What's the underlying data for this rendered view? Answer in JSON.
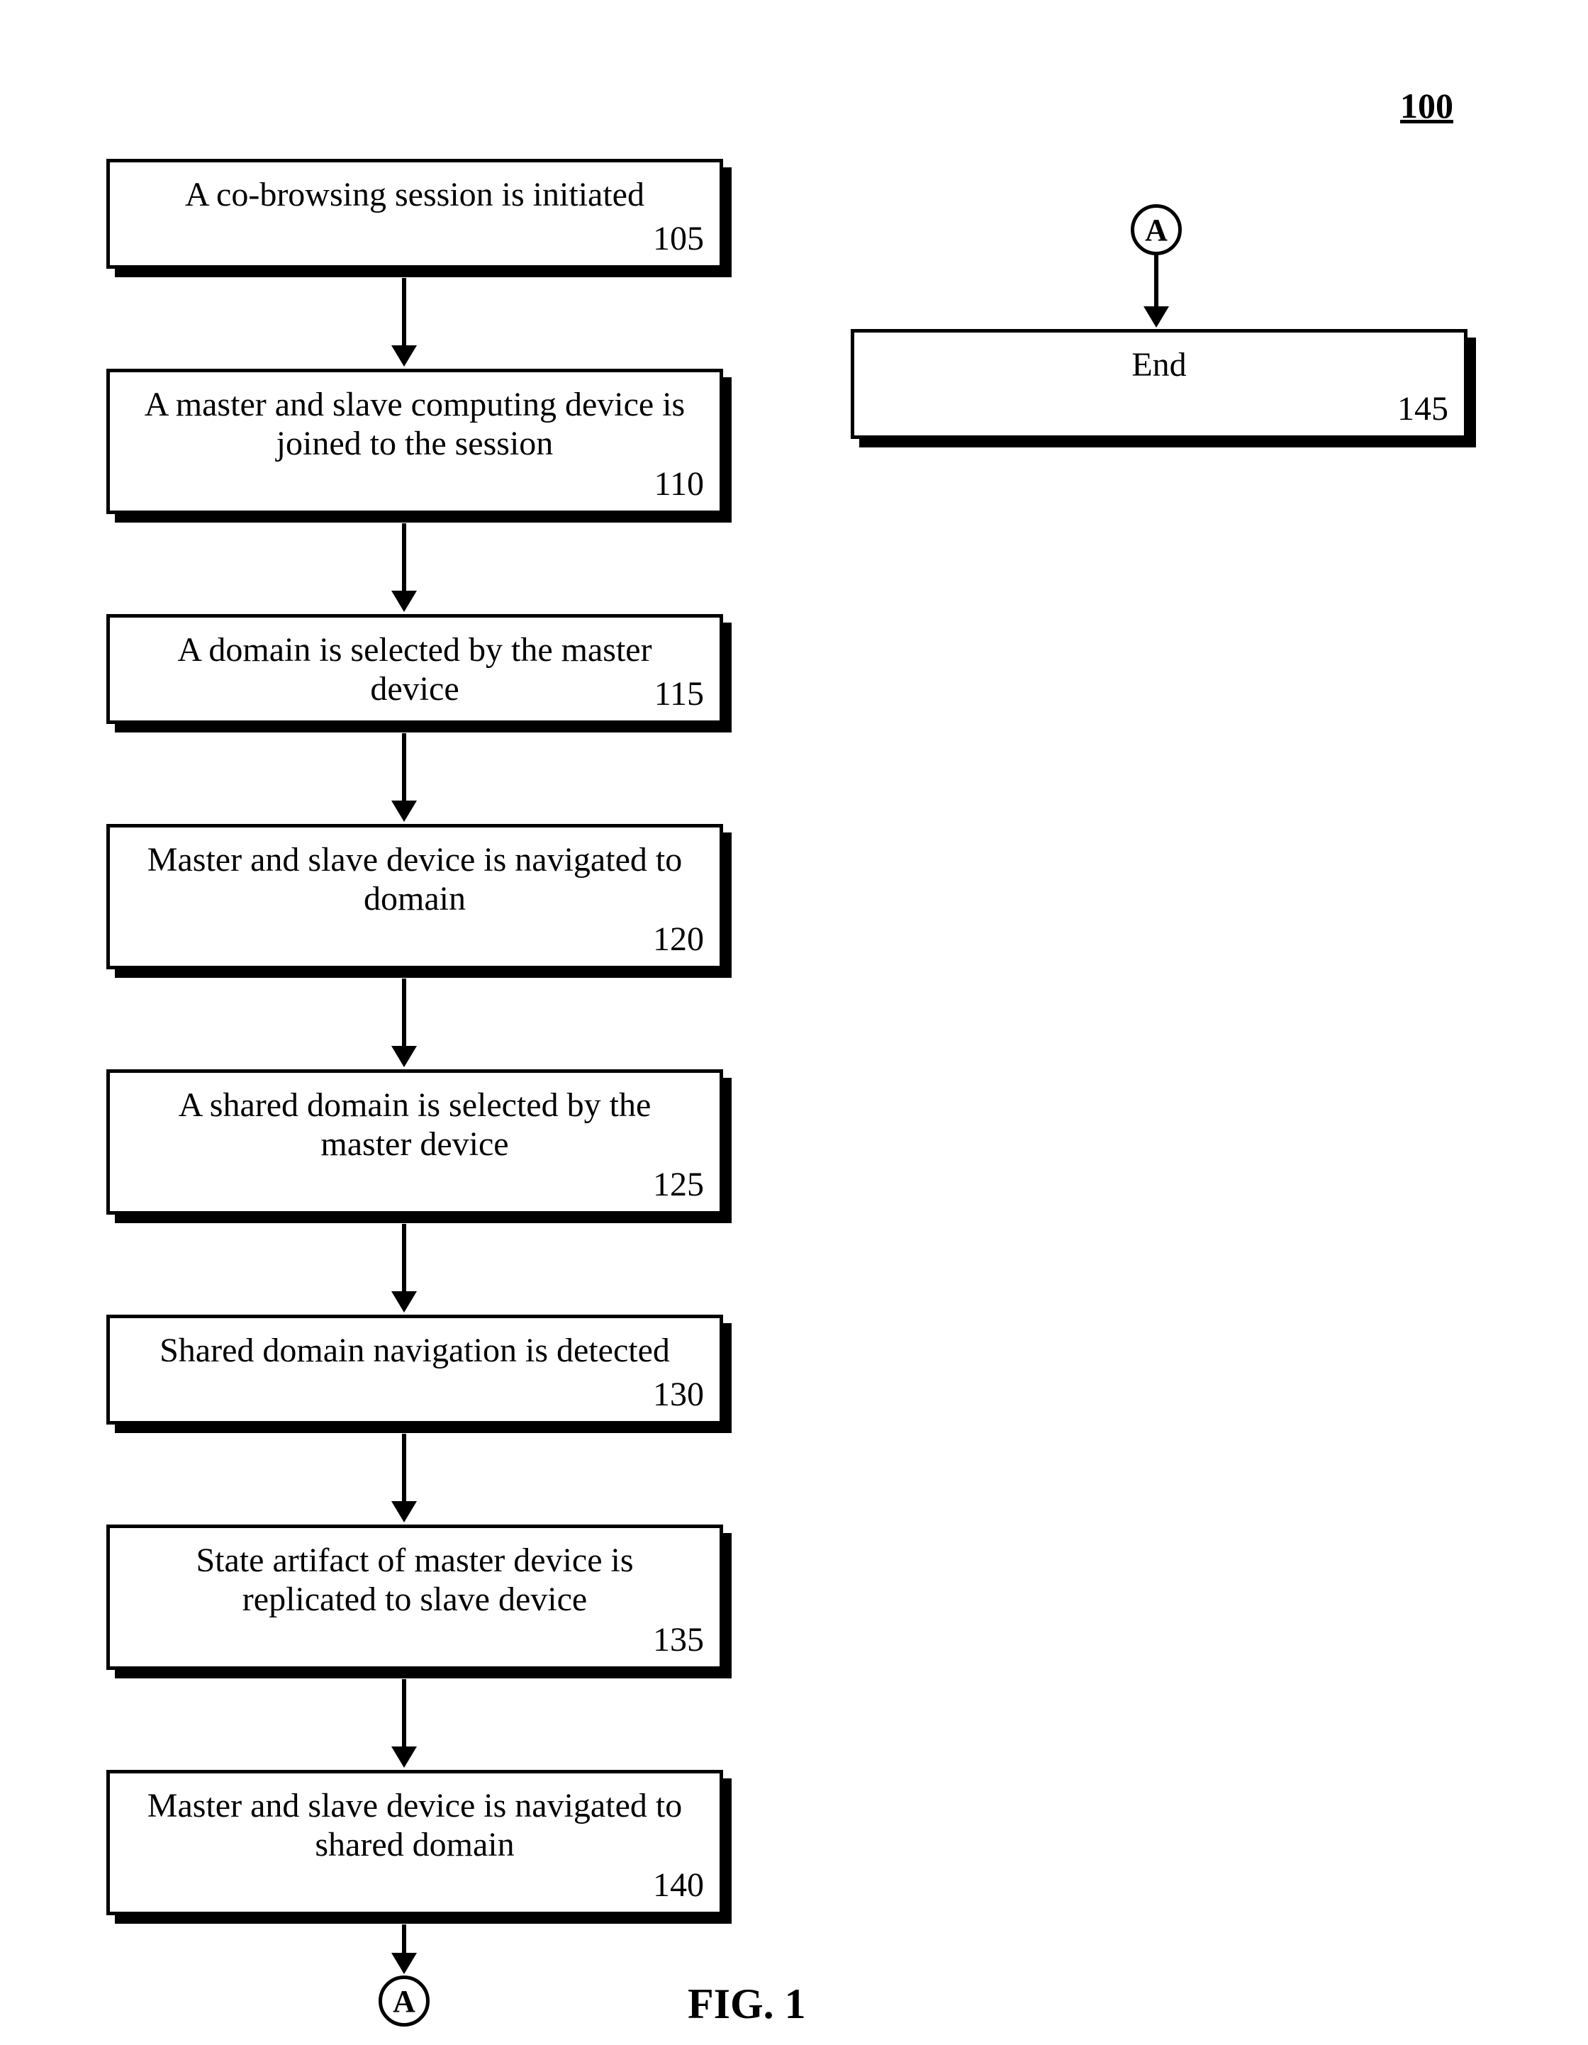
{
  "figure_number": "100",
  "caption": "FIG. 1",
  "connectors": {
    "bottom": "A",
    "top_right": "A"
  },
  "steps": {
    "s105": {
      "text": "A co-browsing session is initiated",
      "num": "105"
    },
    "s110": {
      "text": "A master and slave computing device is joined to the session",
      "num": "110"
    },
    "s115": {
      "text": "A domain is selected by the master device",
      "num": "115"
    },
    "s120": {
      "text": "Master and slave device is navigated to domain",
      "num": "120"
    },
    "s125": {
      "text": "A shared domain is selected by the master device",
      "num": "125"
    },
    "s130": {
      "text": "Shared domain navigation is detected",
      "num": "130"
    },
    "s135": {
      "text": "State artifact of master device is replicated to slave device",
      "num": "135"
    },
    "s140": {
      "text": "Master and slave device is navigated to shared domain",
      "num": "140"
    },
    "s145": {
      "text": "End",
      "num": "145"
    }
  }
}
